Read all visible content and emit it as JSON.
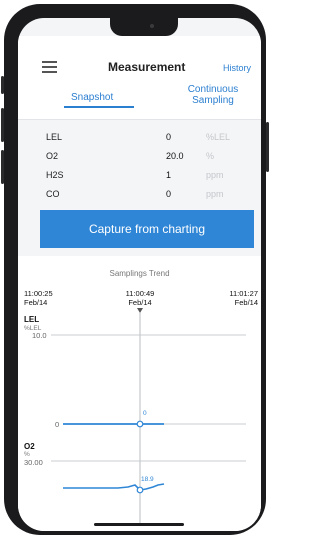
{
  "header": {
    "title": "Measurement",
    "history_link": "History"
  },
  "tabs": [
    {
      "label": "Snapshot",
      "active": true
    },
    {
      "label": "Continuous Sampling",
      "active": false
    }
  ],
  "readings": [
    {
      "gas": "LEL",
      "value": "0",
      "unit": "%LEL"
    },
    {
      "gas": "O2",
      "value": "20.0",
      "unit": "%"
    },
    {
      "gas": "H2S",
      "value": "1",
      "unit": "ppm"
    },
    {
      "gas": "CO",
      "value": "0",
      "unit": "ppm"
    }
  ],
  "capture_button": "Capture from charting",
  "trend": {
    "title": "Samplings Trend",
    "time_start": {
      "time": "11:00:25",
      "date": "Feb/14"
    },
    "time_cursor": {
      "time": "11:00:49",
      "date": "Feb/14"
    },
    "time_end": {
      "time": "11:01:27",
      "date": "Feb/14"
    },
    "lel": {
      "name": "LEL",
      "unit": "%LEL",
      "top_tick": "10.0",
      "bottom_tick": "0",
      "cursor_value": "0"
    },
    "o2": {
      "name": "O2",
      "unit": "%",
      "top_tick": "30.00",
      "cursor_value": "18.9"
    }
  },
  "colors": {
    "accent": "#2f86d6",
    "series": "#2f86d6"
  }
}
